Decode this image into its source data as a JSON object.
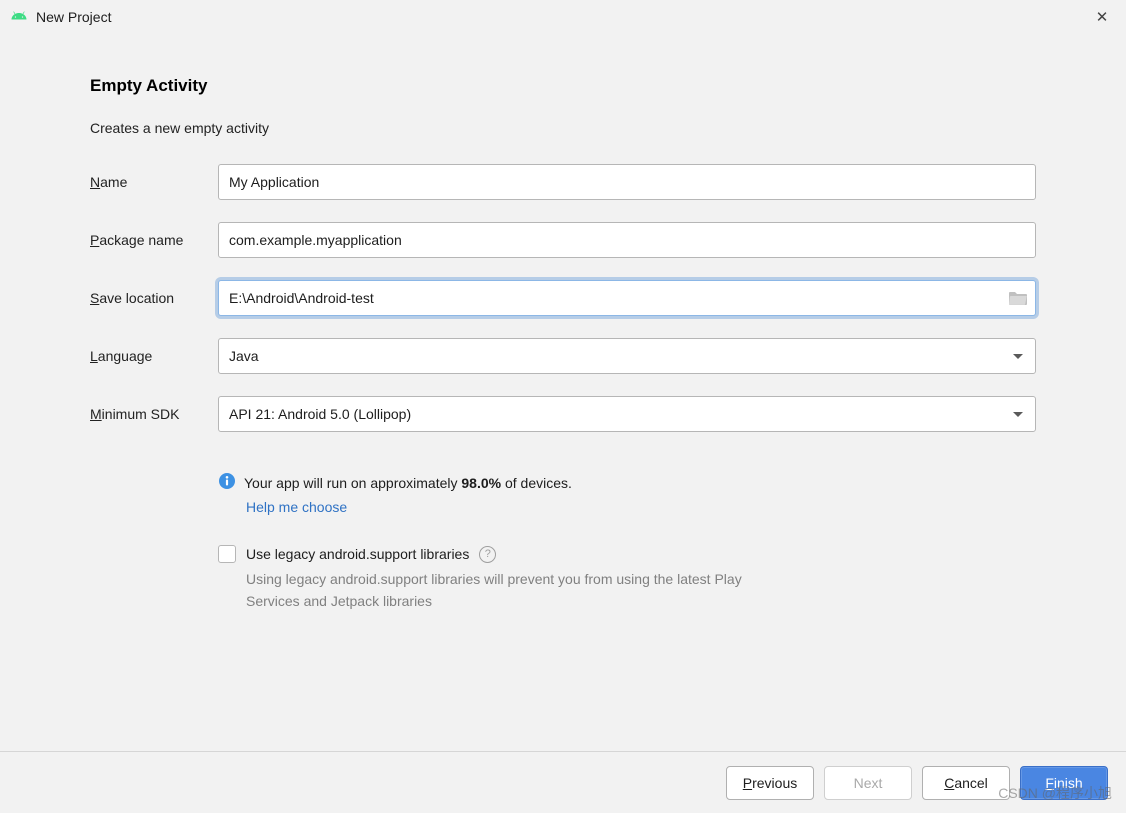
{
  "window": {
    "title": "New Project"
  },
  "header": {
    "title": "Empty Activity",
    "description": "Creates a new empty activity"
  },
  "form": {
    "name": {
      "label_pre": "N",
      "label_rest": "ame",
      "value": "My Application"
    },
    "package": {
      "label_pre": "P",
      "label_rest": "ackage name",
      "value": "com.example.myapplication"
    },
    "save": {
      "label_pre": "S",
      "label_rest": "ave location",
      "value": "E:\\Android\\Android-test"
    },
    "language": {
      "label_pre": "L",
      "label_rest": "anguage",
      "value": "Java"
    },
    "minsdk": {
      "label_pre": "M",
      "label_rest": "inimum SDK",
      "value": "API 21: Android 5.0 (Lollipop)"
    }
  },
  "coverage": {
    "text_pre": "Your app will run on approximately ",
    "percent": "98.0%",
    "text_post": " of devices.",
    "help_link": "Help me choose"
  },
  "legacy": {
    "label": "Use legacy android.support libraries",
    "note": "Using legacy android.support libraries will prevent you from using the latest Play Services and Jetpack libraries"
  },
  "buttons": {
    "previous_pre": "P",
    "previous_rest": "revious",
    "next": "Next",
    "cancel_pre": "C",
    "cancel_rest": "ancel",
    "finish_pre": "F",
    "finish_rest": "inish"
  },
  "watermark": "CSDN @程序小旭"
}
